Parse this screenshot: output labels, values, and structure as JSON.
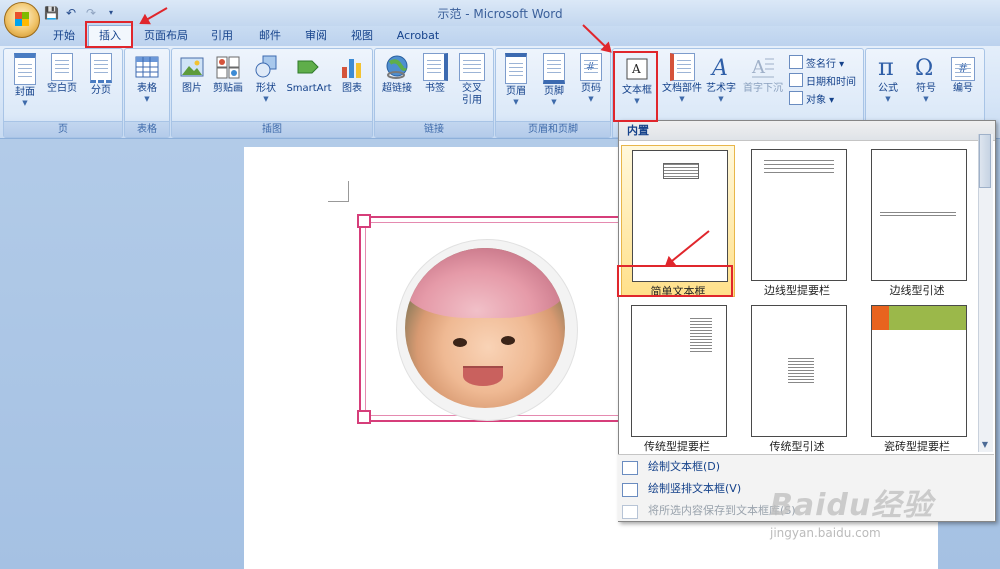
{
  "window": {
    "title": "示范 - Microsoft Word"
  },
  "tabs": [
    {
      "id": "home",
      "label": "开始"
    },
    {
      "id": "insert",
      "label": "插入",
      "active": true
    },
    {
      "id": "layout",
      "label": "页面布局"
    },
    {
      "id": "references",
      "label": "引用"
    },
    {
      "id": "mailings",
      "label": "邮件"
    },
    {
      "id": "review",
      "label": "审阅"
    },
    {
      "id": "view",
      "label": "视图"
    },
    {
      "id": "acrobat",
      "label": "Acrobat"
    }
  ],
  "ribbon": {
    "pages": {
      "label": "页",
      "buttons": {
        "cover": "封面",
        "blank": "空白页",
        "break": "分页"
      }
    },
    "tables": {
      "label": "表格",
      "buttons": {
        "table": "表格"
      }
    },
    "illustrations": {
      "label": "插图",
      "buttons": {
        "picture": "图片",
        "clipart": "剪贴画",
        "shapes": "形状",
        "smartart": "SmartArt",
        "chart": "图表"
      }
    },
    "links": {
      "label": "链接",
      "buttons": {
        "hyperlink": "超链接",
        "bookmark": "书签",
        "crossref_1": "交叉",
        "crossref_2": "引用"
      }
    },
    "header_footer": {
      "label": "页眉和页脚",
      "buttons": {
        "header": "页眉",
        "footer": "页脚",
        "pagenum": "页码"
      }
    },
    "text": {
      "buttons": {
        "textbox": "文本框",
        "quickparts": "文档部件",
        "wordart": "艺术字",
        "dropcap": "首字下沉",
        "signature": "签名行",
        "datetime": "日期和时间",
        "object": "对象"
      }
    },
    "symbols": {
      "buttons": {
        "equation": "公式",
        "symbol": "符号",
        "number": "编号"
      }
    }
  },
  "gallery": {
    "header": "内置",
    "items": [
      {
        "label": "简单文本框"
      },
      {
        "label": "边线型提要栏"
      },
      {
        "label": "边线型引述"
      },
      {
        "label": "传统型提要栏"
      },
      {
        "label": "传统型引述"
      },
      {
        "label": "瓷砖型提要栏"
      }
    ],
    "menu": [
      {
        "label": "绘制文本框(D)"
      },
      {
        "label": "绘制竖排文本框(V)"
      },
      {
        "label": "将所选内容保存到文本框库(S)"
      }
    ]
  },
  "watermark": {
    "text": "Baidu经验",
    "url": "jingyan.baidu.com"
  },
  "colors": {
    "highlight": "#e0262c",
    "frame": "#d63e7a",
    "ribbon": "#dce9f8"
  }
}
